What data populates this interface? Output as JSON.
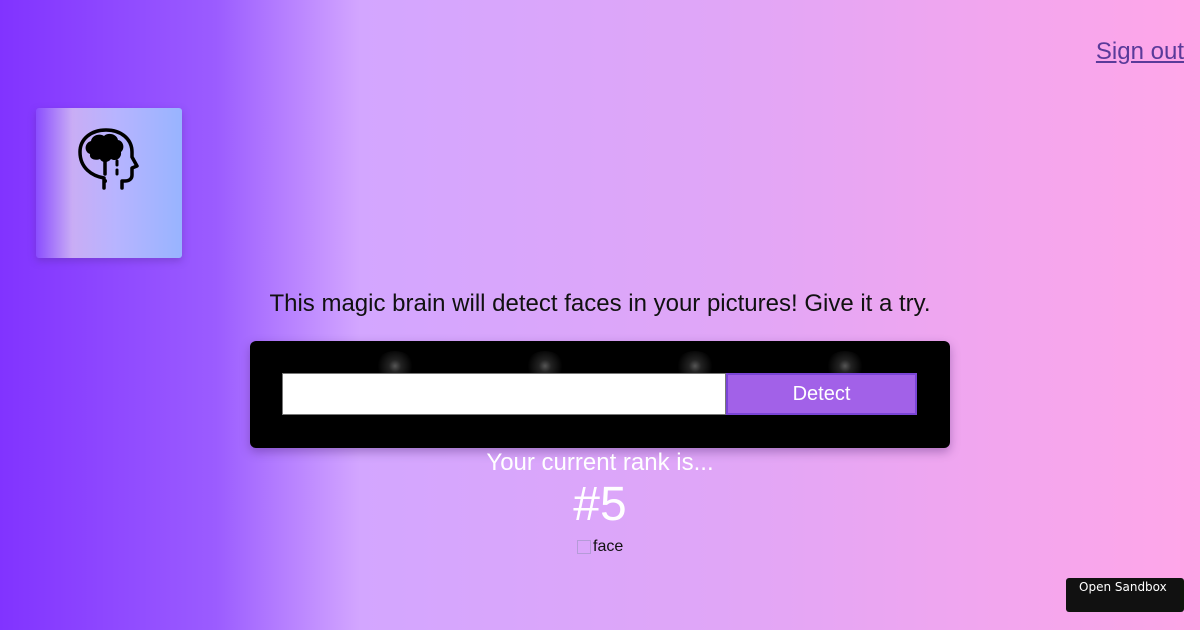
{
  "nav": {
    "signout_label": "Sign out"
  },
  "logo": {
    "icon": "brain-head-icon"
  },
  "intro": {
    "text": "This magic brain will detect faces in your pictures! Give it a try."
  },
  "form": {
    "input_value": "",
    "input_placeholder": "",
    "detect_label": "Detect"
  },
  "rank": {
    "label": "Your current rank is...",
    "value": "#5"
  },
  "image": {
    "alt": "face"
  },
  "sandbox": {
    "label": "Open Sandbox"
  },
  "colors": {
    "gradient_start": "#8133ff",
    "gradient_end": "#ffa6e8",
    "button": "#a261e8",
    "link": "#5a3a9a"
  }
}
